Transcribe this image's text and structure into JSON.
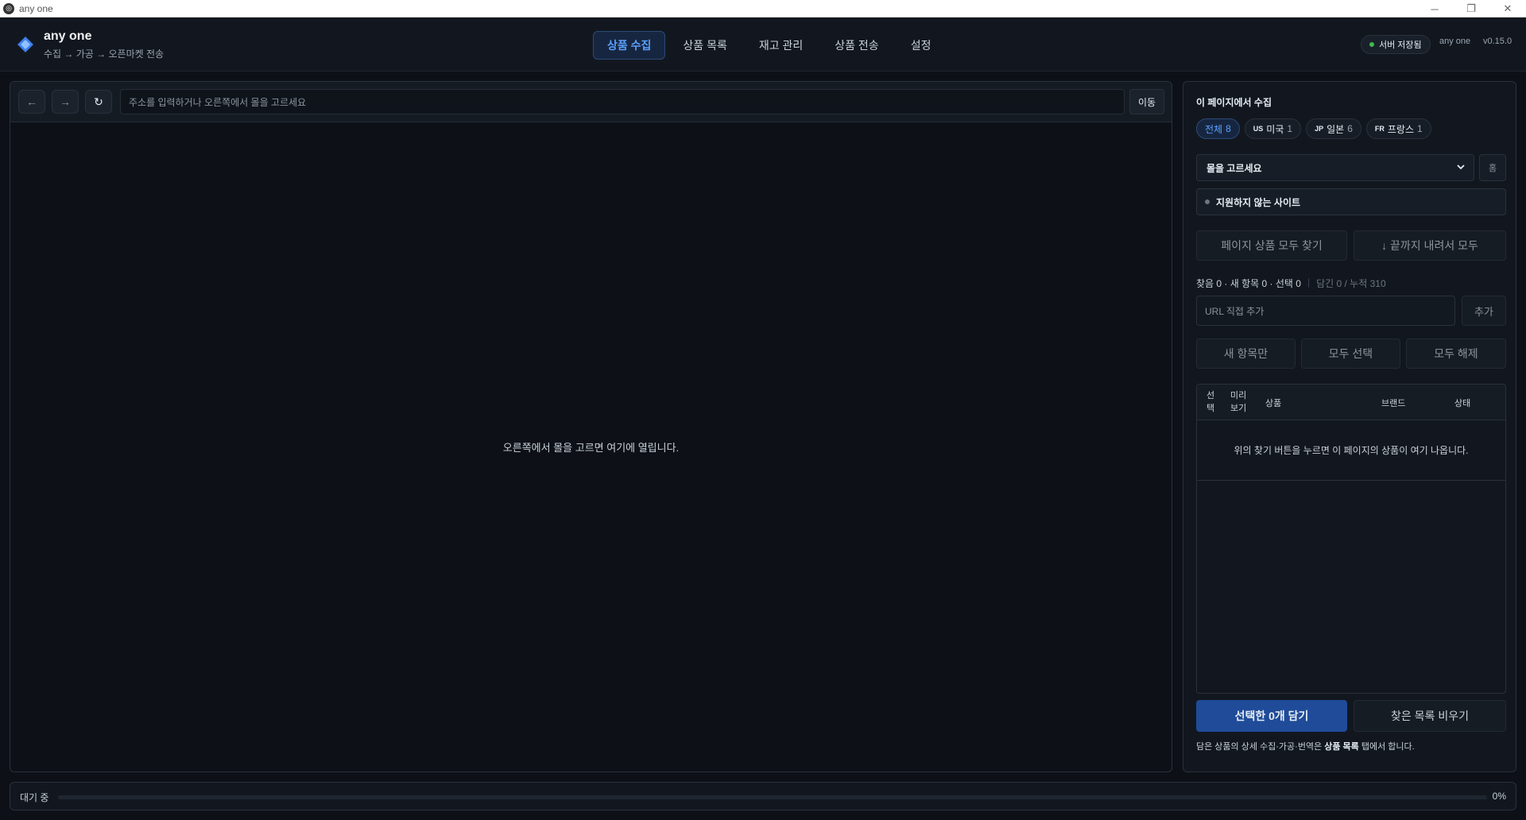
{
  "window": {
    "title": "any one",
    "controls": [
      "─",
      "❐",
      "✕"
    ]
  },
  "header": {
    "app_name": "any one",
    "subtitle": "수집 → 가공 → 오픈마켓 전송",
    "tabs": [
      {
        "label": "상품 수집",
        "active": true
      },
      {
        "label": "상품 목록",
        "active": false
      },
      {
        "label": "재고 관리",
        "active": false
      },
      {
        "label": "상품 전송",
        "active": false
      },
      {
        "label": "설정",
        "active": false
      }
    ],
    "server_status": "서버 저장됨",
    "user": "any one",
    "version": "v0.15.0"
  },
  "browser": {
    "back_icon": "←",
    "forward_icon": "→",
    "refresh_icon": "↻",
    "url_placeholder": "주소를 입력하거나 오른쪽에서 몰을 고르세요",
    "go_label": "이동",
    "empty_message": "오른쪽에서 몰을 고르면 여기에 열립니다."
  },
  "collect": {
    "title": "이 페이지에서 수집",
    "filters": [
      {
        "code": "",
        "label": "전체",
        "count": "8",
        "active": true
      },
      {
        "code": "US",
        "label": "미국",
        "count": "1",
        "active": false
      },
      {
        "code": "JP",
        "label": "일본",
        "count": "6",
        "active": false
      },
      {
        "code": "FR",
        "label": "프랑스",
        "count": "1",
        "active": false
      }
    ],
    "mall_select": "몰을 고르세요",
    "home_label": "홈",
    "site_status": "지원하지 않는 사이트",
    "find_all_label": "페이지 상품 모두 찾기",
    "scroll_all_label": "↓ 끝까지 내려서 모두",
    "stats": {
      "main": "찾음 0 · 새 항목 0 · 선택 0",
      "sub": "담긴 0 / 누적 310"
    },
    "url_placeholder": "URL 직접 추가",
    "add_label": "추가",
    "new_only_label": "새 항목만",
    "select_all_label": "모두 선택",
    "deselect_all_label": "모두 해제",
    "table": {
      "columns": [
        "선\n택",
        "미리\n보기",
        "상품",
        "브랜드",
        "상태"
      ],
      "empty_message": "위의 찾기 버튼을 누르면 이 페이지의 상품이 여기 나옵니다."
    },
    "put_selected_label": "선택한 0개 담기",
    "clear_found_label": "찾은 목록 비우기",
    "footnote_pre": "담은 상품의 상세 수집·가공·번역은 ",
    "footnote_bold": "상품 목록",
    "footnote_post": " 탭에서 합니다."
  },
  "statusbar": {
    "label": "대기 중",
    "percent_text": "0%",
    "progress": 0
  },
  "colors": {
    "accent": "#5ba0ff",
    "primary_button": "#1f4b99",
    "server_ok": "#3fb950",
    "background": "#0d1117"
  }
}
